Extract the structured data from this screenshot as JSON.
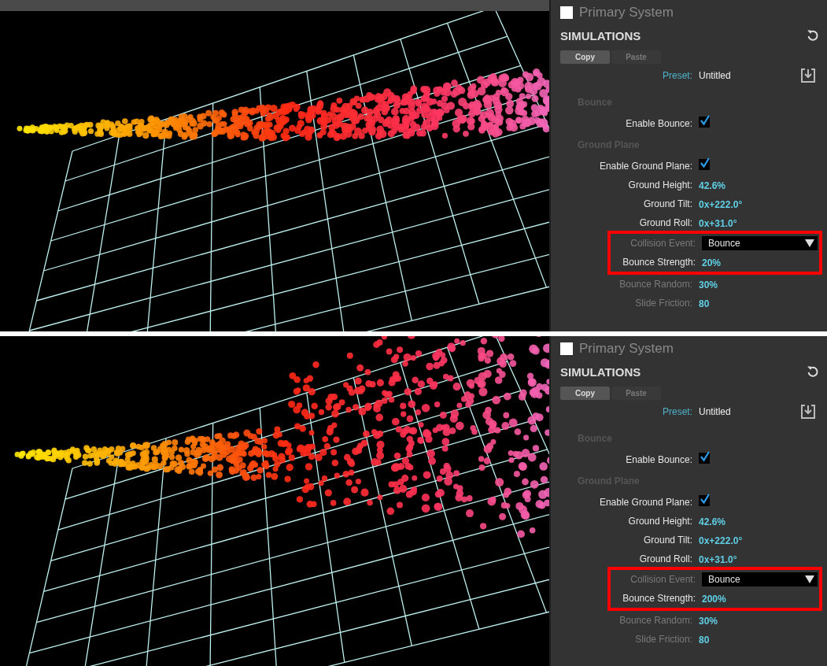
{
  "frames": [
    {
      "panel": {
        "system_title": "Primary System",
        "section_title": "SIMULATIONS",
        "buttons": [
          {
            "label": "Copy",
            "disabled": false
          },
          {
            "label": "Paste",
            "disabled": true
          }
        ],
        "preset": {
          "label": "Preset:",
          "value": "Untitled"
        },
        "rows": [
          {
            "kind": "heading",
            "label": "Bounce"
          },
          {
            "kind": "checkbox",
            "label": "Enable Bounce:",
            "checked": true,
            "dim": false,
            "highlighted": false
          },
          {
            "kind": "heading",
            "label": "Ground Plane"
          },
          {
            "kind": "checkbox",
            "label": "Enable Ground Plane:",
            "checked": true,
            "dim": false,
            "highlighted": false
          },
          {
            "kind": "value",
            "label": "Ground Height:",
            "value": "42.6%",
            "dim": false,
            "highlighted": false
          },
          {
            "kind": "value",
            "label": "Ground Tilt:",
            "value": "0x+222.0°",
            "dim": false,
            "highlighted": false
          },
          {
            "kind": "value",
            "label": "Ground Roll:",
            "value": "0x+31.0°",
            "dim": false,
            "highlighted": false
          },
          {
            "kind": "dropdown",
            "label": "Collision Event:",
            "value": "Bounce",
            "dim": true,
            "highlighted": true
          },
          {
            "kind": "value",
            "label": "Bounce Strength:",
            "value": "20%",
            "dim": false,
            "highlighted": true
          },
          {
            "kind": "value",
            "label": "Bounce Random:",
            "value": "30%",
            "dim": true,
            "highlighted": false
          },
          {
            "kind": "value",
            "label": "Slide Friction:",
            "value": "80",
            "dim": true,
            "highlighted": false
          }
        ]
      }
    },
    {
      "panel": {
        "system_title": "Primary System",
        "section_title": "SIMULATIONS",
        "buttons": [
          {
            "label": "Copy",
            "disabled": false
          },
          {
            "label": "Paste",
            "disabled": true
          }
        ],
        "preset": {
          "label": "Preset:",
          "value": "Untitled"
        },
        "rows": [
          {
            "kind": "heading",
            "label": "Bounce"
          },
          {
            "kind": "checkbox",
            "label": "Enable Bounce:",
            "checked": true,
            "dim": false,
            "highlighted": false
          },
          {
            "kind": "heading",
            "label": "Ground Plane"
          },
          {
            "kind": "checkbox",
            "label": "Enable Ground Plane:",
            "checked": true,
            "dim": false,
            "highlighted": false
          },
          {
            "kind": "value",
            "label": "Ground Height:",
            "value": "42.6%",
            "dim": false,
            "highlighted": false
          },
          {
            "kind": "value",
            "label": "Ground Tilt:",
            "value": "0x+222.0°",
            "dim": false,
            "highlighted": false
          },
          {
            "kind": "value",
            "label": "Ground Roll:",
            "value": "0x+31.0°",
            "dim": false,
            "highlighted": false
          },
          {
            "kind": "dropdown",
            "label": "Collision Event:",
            "value": "Bounce",
            "dim": true,
            "highlighted": true
          },
          {
            "kind": "value",
            "label": "Bounce Strength:",
            "value": "200%",
            "dim": false,
            "highlighted": true
          },
          {
            "kind": "value",
            "label": "Bounce Random:",
            "value": "30%",
            "dim": true,
            "highlighted": false
          },
          {
            "kind": "value",
            "label": "Slide Friction:",
            "value": "80",
            "dim": true,
            "highlighted": false
          }
        ]
      }
    }
  ]
}
